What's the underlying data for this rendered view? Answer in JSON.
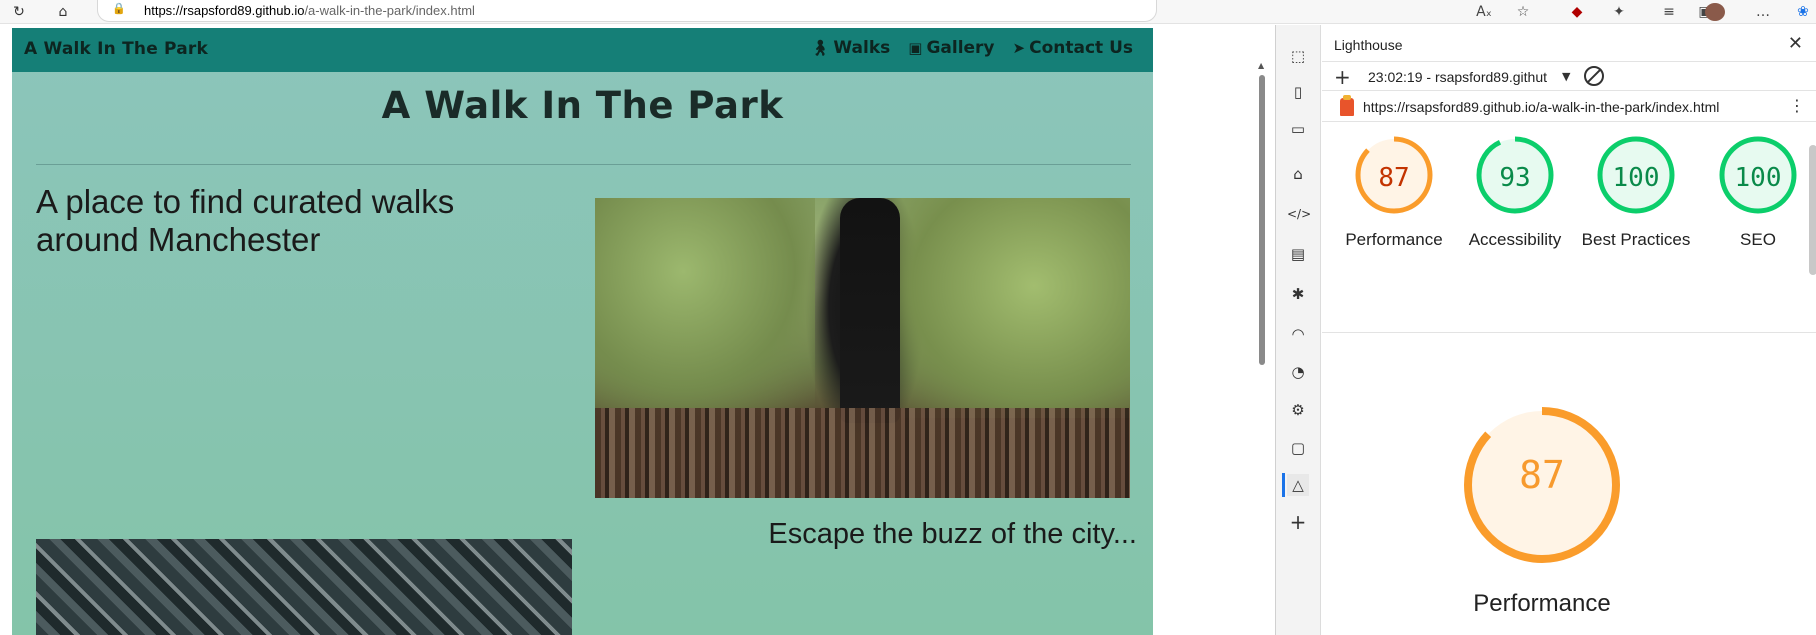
{
  "browser": {
    "url_host": "https://rsapsford89.github.io",
    "url_path": "/a-walk-in-the-park/index.html",
    "reload_icon": "reload-icon",
    "home_icon": "home-icon",
    "lock_icon": "lock-icon"
  },
  "site": {
    "brand": "A Walk In The Park",
    "nav": [
      {
        "label": "Walks",
        "icon": "hiking-icon"
      },
      {
        "label": "Gallery",
        "icon": "camera-icon"
      },
      {
        "label": "Contact Us",
        "icon": "paper-plane-icon"
      }
    ],
    "title": "A Walk In The Park",
    "lead": "A place to find curated walks around Manchester",
    "caption": "Escape the buzz of the city..."
  },
  "devtools": {
    "panel_title": "Lighthouse",
    "run_label": "23:02:19 - rsapsford89.githut",
    "report_url": "https://rsapsford89.github.io/a-walk-in-the-park/index.html",
    "scores": [
      {
        "label": "Performance",
        "value": "87",
        "score": 87,
        "color": "#fa9c2b",
        "text_color": "#c33300",
        "fill": "#fff4e6"
      },
      {
        "label": "Accessibility",
        "value": "93",
        "score": 93,
        "color": "#0cce6b",
        "text_color": "#0a8a4a",
        "fill": "#e7faf0"
      },
      {
        "label": "Best Practices",
        "value": "100",
        "score": 100,
        "color": "#0cce6b",
        "text_color": "#0a8a4a",
        "fill": "#e7faf0"
      },
      {
        "label": "SEO",
        "value": "100",
        "score": 100,
        "color": "#0cce6b",
        "text_color": "#0a8a4a",
        "fill": "#e7faf0"
      }
    ],
    "big_score": {
      "label": "Performance",
      "value": "87",
      "score": 87,
      "color": "#fa9c2b",
      "fill": "#fff4e6"
    }
  }
}
